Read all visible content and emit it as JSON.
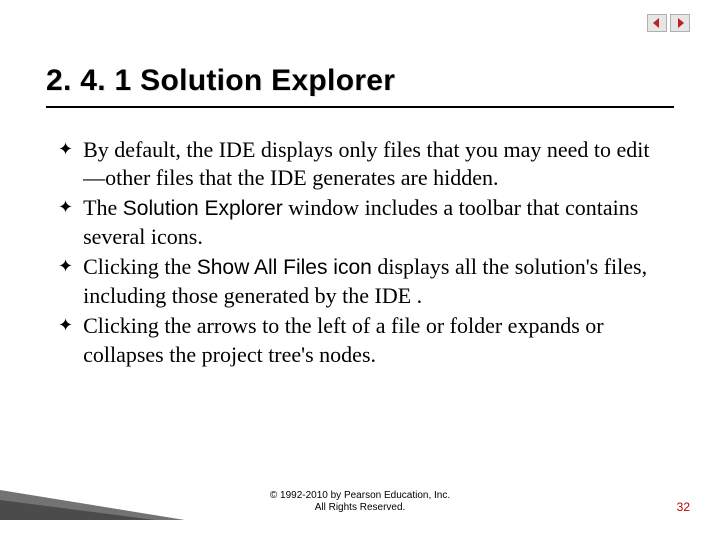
{
  "nav": {
    "prev_label": "Previous",
    "next_label": "Next"
  },
  "title": "2. 4. 1 Solution Explorer",
  "bullets": [
    {
      "pre": "By default, the IDE displays only files that you may need to edit—other files that the IDE generates are hidden."
    },
    {
      "pre": "The ",
      "sans": "Solution Explorer",
      "post": " window includes a toolbar that contains several icons."
    },
    {
      "pre": "Clicking the ",
      "sans": "Show All Files icon",
      "post": "  displays all the solution's files, including those generated by the IDE ."
    },
    {
      "pre": "Clicking the arrows to the left of a file or folder expands or collapses the project tree's nodes."
    }
  ],
  "footer": {
    "line1": "© 1992-2010 by Pearson Education, Inc.",
    "line2": "All Rights Reserved."
  },
  "page_number": "32"
}
